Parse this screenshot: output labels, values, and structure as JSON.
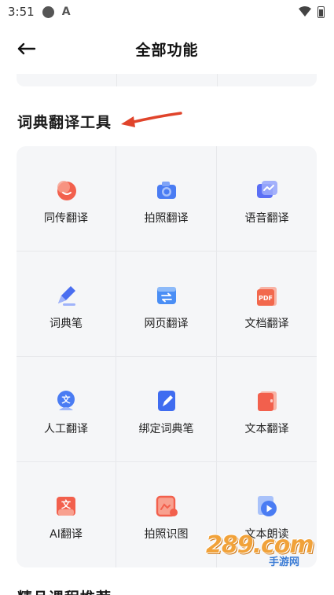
{
  "status_bar": {
    "time": "3:51"
  },
  "header": {
    "title": "全部功能"
  },
  "section": {
    "title": "词典翻译工具",
    "arrow_color": "#e0442b"
  },
  "tools": [
    {
      "label": "同传翻译",
      "icon": "simultaneous-translate-icon",
      "color": "#f2604d"
    },
    {
      "label": "拍照翻译",
      "icon": "camera-translate-icon",
      "color": "#4a7cf3"
    },
    {
      "label": "语音翻译",
      "icon": "voice-translate-icon",
      "color": "#5b6ff5"
    },
    {
      "label": "词典笔",
      "icon": "dictionary-pen-icon",
      "color": "#4a6ef0"
    },
    {
      "label": "网页翻译",
      "icon": "webpage-translate-icon",
      "color": "#4a8ef5"
    },
    {
      "label": "文档翻译",
      "icon": "document-translate-icon",
      "color": "#f2684d"
    },
    {
      "label": "人工翻译",
      "icon": "human-translate-icon",
      "color": "#4a7cf3"
    },
    {
      "label": "绑定词典笔",
      "icon": "bind-pen-icon",
      "color": "#3f6cf0"
    },
    {
      "label": "文本翻译",
      "icon": "text-translate-icon",
      "color": "#f2604d"
    },
    {
      "label": "AI翻译",
      "icon": "ai-translate-icon",
      "color": "#f2604d"
    },
    {
      "label": "拍照识图",
      "icon": "photo-recognize-icon",
      "color": "#f2604d"
    },
    {
      "label": "文本朗读",
      "icon": "text-read-aloud-icon",
      "color": "#4a7cf3"
    }
  ],
  "next_section": {
    "title": "精品课程推荐"
  },
  "watermark": {
    "big": "289.com",
    "small": "手游网"
  }
}
